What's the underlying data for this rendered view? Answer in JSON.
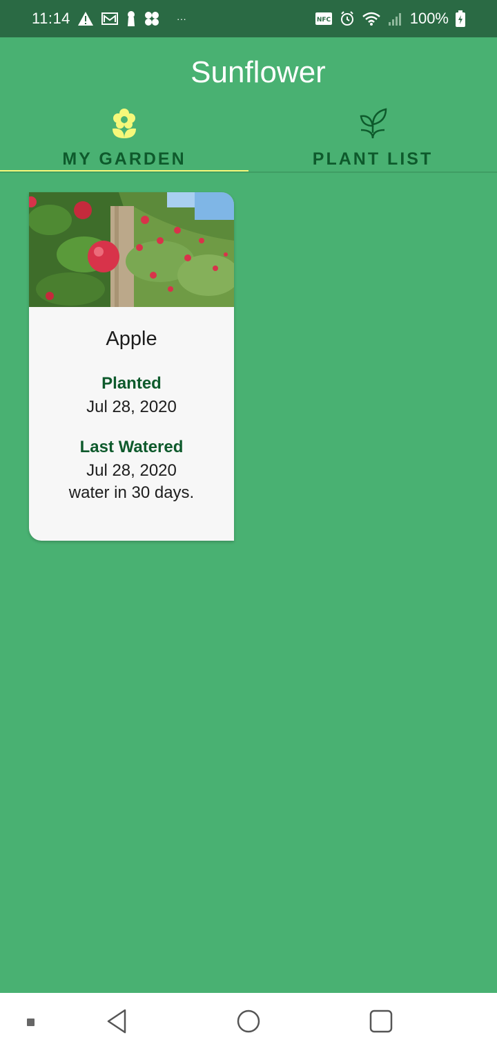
{
  "status_bar": {
    "time": "11:14",
    "battery": "100%",
    "left_icons": [
      "warning-icon",
      "mail-icon",
      "keyhole-icon",
      "fan-icon",
      "more-icon"
    ],
    "right_icons": [
      "nfc-icon",
      "alarm-icon",
      "wifi-icon",
      "signal-icon",
      "battery-icon"
    ]
  },
  "app_bar": {
    "title": "Sunflower"
  },
  "tabs": [
    {
      "label": "MY GARDEN",
      "icon": "flower-icon",
      "selected": true
    },
    {
      "label": "PLANT LIST",
      "icon": "sprout-icon",
      "selected": false
    }
  ],
  "garden": {
    "plants": [
      {
        "name": "Apple",
        "image": "apple-tree-photo",
        "planted_label": "Planted",
        "planted_date": "Jul 28, 2020",
        "watered_label": "Last Watered",
        "watered_date": "Jul 28, 2020",
        "water_interval": "water in 30 days."
      }
    ]
  },
  "nav_bar": {
    "items": [
      "menu-dot-icon",
      "back-icon",
      "home-icon",
      "recents-icon"
    ]
  },
  "colors": {
    "status_bar": "#2a6a44",
    "primary": "#49b172",
    "tab_text": "#0e5a2c",
    "indicator": "#f6f87a",
    "card": "#f7f7f7"
  }
}
